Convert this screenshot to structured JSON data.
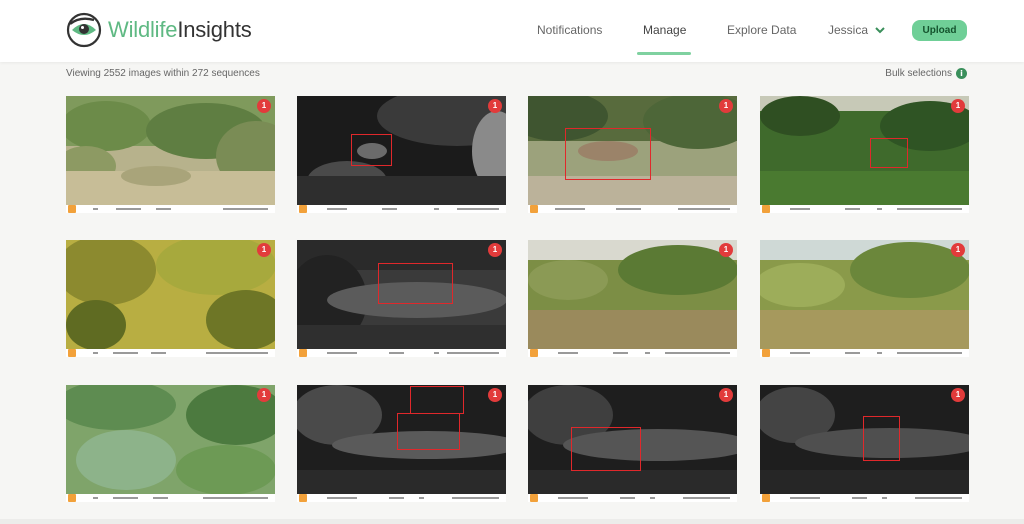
{
  "header": {
    "brand_part1": "Wildlife",
    "brand_part2": "Insights",
    "nav": [
      {
        "label": "Notifications",
        "active": false
      },
      {
        "label": "Manage",
        "active": true
      },
      {
        "label": "Explore Data",
        "active": false
      }
    ],
    "user_name": "Jessica",
    "upload_label": "Upload",
    "accent_color": "#6fcf97"
  },
  "summary": {
    "viewing_text": "Viewing 2552 images within 272 sequences",
    "bulk_label": "Bulk selections",
    "bulk_info_icon": "i"
  },
  "images": [
    {
      "count": "1",
      "scene": "day-brush",
      "detections": 0
    },
    {
      "count": "1",
      "scene": "night-ir",
      "detections": 1
    },
    {
      "count": "1",
      "scene": "day-coyote",
      "detections": 1
    },
    {
      "count": "1",
      "scene": "day-dark-green",
      "detections": 1
    },
    {
      "count": "1",
      "scene": "day-yellow-brush",
      "detections": 0
    },
    {
      "count": "1",
      "scene": "night-ir",
      "detections": 1
    },
    {
      "count": "1",
      "scene": "day-brush",
      "detections": 0
    },
    {
      "count": "1",
      "scene": "day-brush",
      "detections": 0
    },
    {
      "count": "1",
      "scene": "day-green-plants",
      "detections": 0
    },
    {
      "count": "1",
      "scene": "night-ir",
      "detections": 2
    },
    {
      "count": "1",
      "scene": "night-ir",
      "detections": 1
    },
    {
      "count": "1",
      "scene": "night-ir",
      "detections": 1
    }
  ]
}
